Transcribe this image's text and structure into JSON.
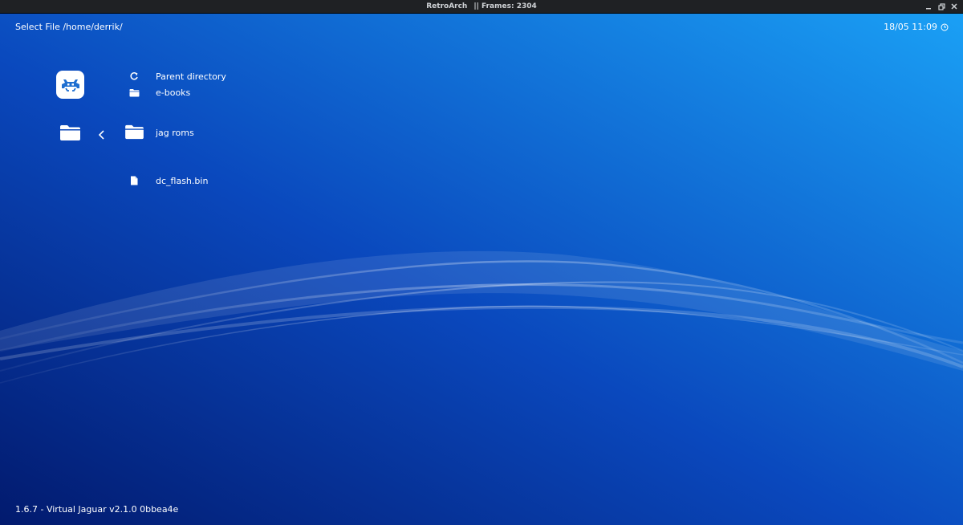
{
  "window": {
    "app_name": "RetroArch",
    "frames_label": "|| Frames: 2304"
  },
  "header": {
    "title": "Select File /home/derrik/",
    "clock": "18/05 11:09"
  },
  "files": [
    {
      "label": "Parent directory",
      "icon": "refresh-icon"
    },
    {
      "label": "e-books",
      "icon": "folder-icon"
    },
    {
      "label": "jag roms",
      "icon": "folder-icon",
      "selected": true
    },
    {
      "label": "dc_flash.bin",
      "icon": "file-icon"
    }
  ],
  "footer": {
    "version": "1.6.7 - Virtual Jaguar v2.1.0 0bbea4e"
  },
  "colors": {
    "bg_top_right": "#1aa0f5",
    "bg_bottom_left": "#021a6e",
    "text": "#ffffff"
  }
}
